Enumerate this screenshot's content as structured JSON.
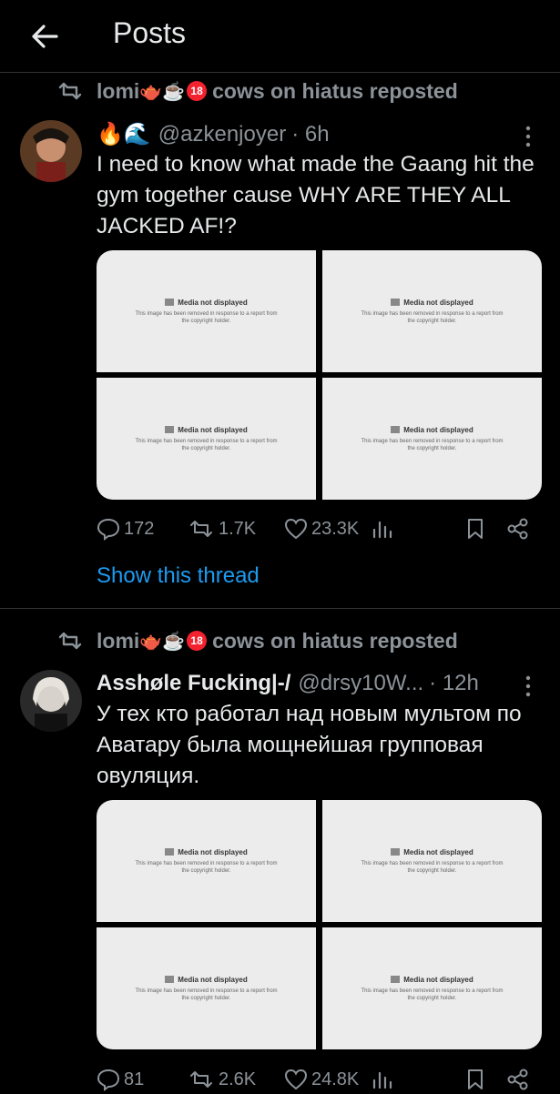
{
  "header": {
    "title": "Posts"
  },
  "posts": [
    {
      "repost_user": "lomi",
      "repost_suffix": "cows on hiatus reposted",
      "author_emoji": "🔥🌊",
      "author_name": "",
      "handle": "@azkenjoyer",
      "time": "· 6h",
      "text": "I need to know what made the Gaang hit the gym together cause WHY ARE THEY ALL JACKED AF!?",
      "media": [
        {
          "title": "Media not displayed",
          "desc": "This image has been removed in response to a report from the copyright holder."
        },
        {
          "title": "Media not displayed",
          "desc": "This image has been removed in response to a report from the copyright holder."
        },
        {
          "title": "Media not displayed",
          "desc": "This image has been removed in response to a report from the copyright holder."
        },
        {
          "title": "Media not displayed",
          "desc": "This image has been removed in response to a report from the copyright holder."
        }
      ],
      "replies": "172",
      "reposts": "1.7K",
      "likes": "23.3K",
      "show_thread": "Show this thread"
    },
    {
      "repost_user": "lomi",
      "repost_suffix": "cows on hiatus reposted",
      "author_name": "Asshøle Fucking|-/",
      "handle": "@drsy10W...",
      "time": "· 12h",
      "text": "У тех кто работал над новым мультом по Аватару была мощнейшая групповая овуляция.",
      "media": [
        {
          "title": "Media not displayed",
          "desc": "This image has been removed in response to a report from the copyright holder."
        },
        {
          "title": "Media not displayed",
          "desc": "This image has been removed in response to a report from the copyright holder."
        },
        {
          "title": "Media not displayed",
          "desc": "This image has been removed in response to a report from the copyright holder."
        },
        {
          "title": "Media not displayed",
          "desc": "This image has been removed in response to a report from the copyright holder."
        }
      ],
      "replies": "81",
      "reposts": "2.6K",
      "likes": "24.8K"
    }
  ],
  "colors": {
    "accent": "#1d9bf0",
    "muted": "#8b9298",
    "text": "#e7e9ea",
    "background": "#000000"
  }
}
